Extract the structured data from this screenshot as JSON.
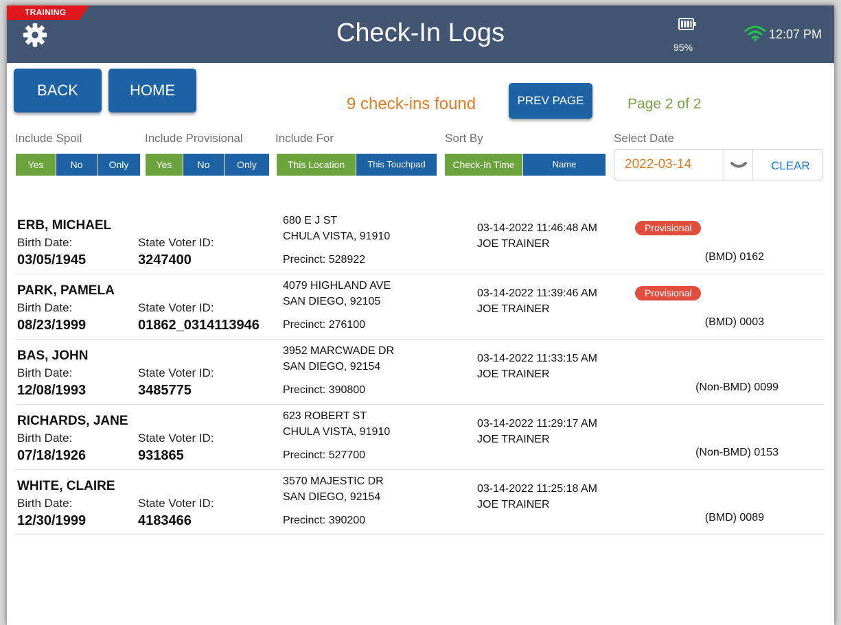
{
  "header": {
    "training_label": "TRAINING",
    "title": "Check-In Logs",
    "battery_percent": "95%",
    "time": "12:07 PM",
    "icons": [
      "gear-icon",
      "battery-icon",
      "wifi-icon"
    ]
  },
  "nav": {
    "back_label": "BACK",
    "home_label": "HOME",
    "results_text": "9 check-ins found",
    "prev_page_label": "PREV PAGE",
    "page_indicator": "Page 2 of 2"
  },
  "filters": {
    "include_spoil": {
      "label": "Include Spoil",
      "options": [
        "Yes",
        "No",
        "Only"
      ],
      "selected": "Yes"
    },
    "include_provisional": {
      "label": "Include Provisional",
      "options": [
        "Yes",
        "No",
        "Only"
      ],
      "selected": "Yes"
    },
    "include_for": {
      "label": "Include For",
      "options": [
        "This Location",
        "This Touchpad"
      ],
      "selected": "This Location"
    },
    "sort_by": {
      "label": "Sort By",
      "options": [
        "Check-In Time",
        "Name"
      ],
      "selected": "Check-In Time"
    },
    "select_date": {
      "label": "Select Date",
      "value": "2022-03-14",
      "clear_label": "CLEAR"
    }
  },
  "labels": {
    "birth_date": "Birth Date:",
    "state_voter_id": "State Voter ID:"
  },
  "colors": {
    "header_bg": "#425673",
    "button_blue": "#1c62a4",
    "selected_green": "#6ba43c",
    "orange_text": "#e07b26",
    "page_green": "#78a24c",
    "provisional_red": "#e34d3e",
    "training_red": "#e0171d"
  },
  "records": [
    {
      "name": "ERB, MICHAEL",
      "birth_date": "03/05/1945",
      "voter_id": "3247400",
      "address1": "680 E J ST",
      "address2": "CHULA VISTA, 91910",
      "precinct": "Precinct: 528922",
      "timestamp": "03-14-2022 11:46:48 AM",
      "checked_in_by": "JOE TRAINER",
      "badge": "Provisional",
      "device": "(BMD) 0162"
    },
    {
      "name": "PARK, PAMELA",
      "birth_date": "08/23/1999",
      "voter_id": "01862_0314113946",
      "address1": "4079 HIGHLAND AVE",
      "address2": "SAN DIEGO, 92105",
      "precinct": "Precinct: 276100",
      "timestamp": "03-14-2022 11:39:46 AM",
      "checked_in_by": "JOE TRAINER",
      "badge": "Provisional",
      "device": "(BMD) 0003"
    },
    {
      "name": "BAS, JOHN",
      "birth_date": "12/08/1993",
      "voter_id": "3485775",
      "address1": "3952 MARCWADE DR",
      "address2": "SAN DIEGO, 92154",
      "precinct": "Precinct: 390800",
      "timestamp": "03-14-2022 11:33:15 AM",
      "checked_in_by": "JOE TRAINER",
      "badge": "",
      "device": "(Non-BMD) 0099"
    },
    {
      "name": "RICHARDS, JANE",
      "birth_date": "07/18/1926",
      "voter_id": "931865",
      "address1": "623 ROBERT  ST",
      "address2": "CHULA VISTA, 91910",
      "precinct": "Precinct: 527700",
      "timestamp": "03-14-2022 11:29:17 AM",
      "checked_in_by": "JOE TRAINER",
      "badge": "",
      "device": "(Non-BMD) 0153"
    },
    {
      "name": "WHITE, CLAIRE",
      "birth_date": "12/30/1999",
      "voter_id": "4183466",
      "address1": "3570 MAJESTIC  DR",
      "address2": "SAN DIEGO, 92154",
      "precinct": "Precinct: 390200",
      "timestamp": "03-14-2022 11:25:18 AM",
      "checked_in_by": "JOE TRAINER",
      "badge": "",
      "device": "(BMD) 0089"
    }
  ]
}
